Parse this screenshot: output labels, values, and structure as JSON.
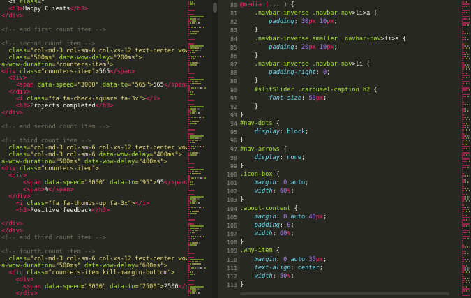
{
  "colors": {
    "background": "#272822",
    "tag": "#f92672",
    "attribute": "#a6e22e",
    "string": "#e6db74",
    "comment": "#75715e",
    "text": "#f8f8f2",
    "property": "#66d9ef",
    "number": "#ae81ff",
    "gutter_number": "#8f908a"
  },
  "left_editor": {
    "lines": [
      [
        [
          "  <i ",
          "txt"
        ],
        [
          "class",
          "attr"
        ],
        [
          "=\"",
          "txt"
        ]
      ],
      [
        [
          "  <h3>",
          "tag"
        ],
        [
          "Happy Clients",
          "txt"
        ],
        [
          "</h3>",
          "tag"
        ]
      ],
      [
        [
          "</div>",
          "tag"
        ]
      ],
      [
        [
          "",
          ""
        ]
      ],
      [
        [
          "<!-- end first count item -->",
          "cmt"
        ]
      ],
      [
        [
          "",
          ""
        ]
      ],
      [
        [
          "<!-- second count item -->",
          "cmt"
        ]
      ],
      [
        [
          "  class",
          "attr"
        ],
        [
          "=\"col-md-3 col-sm-6 col-xs-12 text-center wow fadeInDown\"",
          "str"
        ]
      ],
      [
        [
          "  class",
          "attr"
        ],
        [
          "=\"500ms\" ",
          "str"
        ],
        [
          "data-wow-delay",
          "attr"
        ],
        [
          "=\"200ms\">",
          "str"
        ]
      ],
      [
        [
          "a-wow-duration",
          "attr"
        ],
        [
          "=\"counters-item\">",
          "str"
        ]
      ],
      [
        [
          "<div ",
          "tag"
        ],
        [
          "class",
          "attr"
        ],
        [
          "=\"counters-item\">",
          "str"
        ],
        [
          "565",
          "txt"
        ],
        [
          "</span>",
          "tag"
        ]
      ],
      [
        [
          "  <div>",
          "tag"
        ]
      ],
      [
        [
          "    <span ",
          "tag"
        ],
        [
          "data-speed",
          "attr"
        ],
        [
          "=\"3000\" ",
          "str"
        ],
        [
          "data-to",
          "attr"
        ],
        [
          "=\"565\">",
          "str"
        ],
        [
          "565",
          "txt"
        ],
        [
          "</span>",
          "tag"
        ]
      ],
      [
        [
          "  </div>",
          "tag"
        ]
      ],
      [
        [
          "    <i ",
          "tag"
        ],
        [
          "class",
          "attr"
        ],
        [
          "=\"fa fa-check-square fa-3x\">",
          "str"
        ],
        [
          "</i>",
          "tag"
        ]
      ],
      [
        [
          "    <h3>",
          "tag"
        ],
        [
          "Projects completed",
          "txt"
        ],
        [
          "</h3>",
          "tag"
        ]
      ],
      [
        [
          "</div>",
          "tag"
        ]
      ],
      [
        [
          "",
          ""
        ]
      ],
      [
        [
          "<!-- end second count item -->",
          "cmt"
        ]
      ],
      [
        [
          "",
          ""
        ]
      ],
      [
        [
          "<!-- third count item -->",
          "cmt"
        ]
      ],
      [
        [
          "  class",
          "attr"
        ],
        [
          "=\"col-md-3 col-sm-6 col-xs-12 text-center wow fadeInDown\"",
          "str"
        ]
      ],
      [
        [
          "  class",
          "attr"
        ],
        [
          "=\"col-md-3 col-sm-6 ",
          "str"
        ],
        [
          "data-wow-delay",
          "attr"
        ],
        [
          "=\"400ms\">",
          "str"
        ]
      ],
      [
        [
          "a-wow-duration",
          "attr"
        ],
        [
          "=\"500ms\" ",
          "str"
        ],
        [
          "data-wow-delay",
          "attr"
        ],
        [
          "=\"400ms\">",
          "str"
        ]
      ],
      [
        [
          "<div ",
          "tag"
        ],
        [
          "class",
          "attr"
        ],
        [
          "=\"counters-item\">",
          "str"
        ]
      ],
      [
        [
          "  <div>",
          "tag"
        ]
      ],
      [
        [
          "      <span ",
          "tag"
        ],
        [
          "data-speed",
          "attr"
        ],
        [
          "=\"3000\" ",
          "str"
        ],
        [
          "data-to",
          "attr"
        ],
        [
          "=\"95\">",
          "str"
        ],
        [
          "95",
          "txt"
        ],
        [
          "</span>",
          "tag"
        ]
      ],
      [
        [
          "      <span>",
          "tag"
        ],
        [
          "%",
          "txt"
        ],
        [
          "</span>",
          "tag"
        ]
      ],
      [
        [
          "  </div>",
          "tag"
        ]
      ],
      [
        [
          "    <i ",
          "tag"
        ],
        [
          "class",
          "attr"
        ],
        [
          "=\"fa fa-thumbs-up fa-3x\">",
          "str"
        ],
        [
          "</i>",
          "tag"
        ]
      ],
      [
        [
          "    <h3>",
          "tag"
        ],
        [
          "Positive feedback",
          "txt"
        ],
        [
          "</h3>",
          "tag"
        ]
      ],
      [
        [
          "",
          ""
        ]
      ],
      [
        [
          "</div>",
          "tag"
        ]
      ],
      [
        [
          "</div>",
          "tag"
        ]
      ],
      [
        [
          "<!-- end third count item -->",
          "cmt"
        ]
      ],
      [
        [
          "",
          ""
        ]
      ],
      [
        [
          "<!-- fourth count item -->",
          "cmt"
        ]
      ],
      [
        [
          "  class",
          "attr"
        ],
        [
          "=\"col-md-3 col-sm-6 col-xs-12 text-center wow fadeInDown\"",
          "str"
        ]
      ],
      [
        [
          "a-wow-duration",
          "attr"
        ],
        [
          "=\"500ms\" ",
          "str"
        ],
        [
          "data-wow-delay",
          "attr"
        ],
        [
          "=\"600ms\">",
          "str"
        ]
      ],
      [
        [
          "  <div ",
          "tag"
        ],
        [
          "class",
          "attr"
        ],
        [
          "=\"counters-item kill-margin-bottom\">",
          "str"
        ]
      ],
      [
        [
          "    <div>",
          "tag"
        ]
      ],
      [
        [
          "      <span ",
          "tag"
        ],
        [
          "data-speed",
          "attr"
        ],
        [
          "=\"3000\" ",
          "str"
        ],
        [
          "data-to",
          "attr"
        ],
        [
          "=\"2500\">",
          "str"
        ],
        [
          "2500",
          "txt"
        ],
        [
          "</span>",
          "tag"
        ]
      ],
      [
        [
          "    </div>",
          "tag"
        ]
      ]
    ]
  },
  "right_editor": {
    "lines": [
      {
        "n": "80",
        "tokens": [
          [
            "@media (",
            "at"
          ],
          [
            "... ",
            "txt"
          ],
          [
            ") {",
            "txt"
          ]
        ]
      },
      {
        "n": "81",
        "tokens": [
          [
            "    .navbar-inverse .navbar-nav",
            "sel"
          ],
          [
            ">li>a {",
            "txt"
          ]
        ]
      },
      {
        "n": "82",
        "tokens": [
          [
            "        padding",
            "prop"
          ],
          [
            ": ",
            "txt"
          ],
          [
            "30",
            "num"
          ],
          [
            "px ",
            "unit"
          ],
          [
            "10",
            "num"
          ],
          [
            "px",
            "unit"
          ],
          [
            ";",
            "txt"
          ]
        ]
      },
      {
        "n": "83",
        "tokens": [
          [
            "    }",
            "txt"
          ]
        ]
      },
      {
        "n": "84",
        "tokens": [
          [
            "    .navbar-inverse.smaller .navbar-nav",
            "sel"
          ],
          [
            ">li>a {",
            "txt"
          ]
        ]
      },
      {
        "n": "85",
        "tokens": [
          [
            "        padding",
            "prop"
          ],
          [
            ": ",
            "txt"
          ],
          [
            "20",
            "num"
          ],
          [
            "px ",
            "unit"
          ],
          [
            "10",
            "num"
          ],
          [
            "px",
            "unit"
          ],
          [
            ";",
            "txt"
          ]
        ]
      },
      {
        "n": "86",
        "tokens": [
          [
            "    }",
            "txt"
          ]
        ]
      },
      {
        "n": "87",
        "tokens": [
          [
            "    .navbar-inverse .navbar-nav",
            "sel"
          ],
          [
            ">li {",
            "txt"
          ]
        ]
      },
      {
        "n": "88",
        "tokens": [
          [
            "        padding-right",
            "prop"
          ],
          [
            ": ",
            "txt"
          ],
          [
            "0",
            "num"
          ],
          [
            ";",
            "txt"
          ]
        ]
      },
      {
        "n": "89",
        "tokens": [
          [
            "    }",
            "txt"
          ]
        ]
      },
      {
        "n": "90",
        "tokens": [
          [
            "    #slitSlider .carousel-caption h2",
            "sel"
          ],
          [
            " {",
            "txt"
          ]
        ]
      },
      {
        "n": "91",
        "tokens": [
          [
            "        font-size",
            "prop"
          ],
          [
            ": ",
            "txt"
          ],
          [
            "50",
            "num"
          ],
          [
            "px",
            "unit"
          ],
          [
            ";",
            "txt"
          ]
        ]
      },
      {
        "n": "92",
        "tokens": [
          [
            "    }",
            "txt"
          ]
        ]
      },
      {
        "n": "93",
        "tokens": [
          [
            "}",
            "txt"
          ]
        ]
      },
      {
        "n": "94",
        "tokens": [
          [
            "#nav-dots",
            "sel"
          ],
          [
            " {",
            "txt"
          ]
        ]
      },
      {
        "n": "95",
        "tokens": [
          [
            "    display",
            "prop"
          ],
          [
            ": ",
            "txt"
          ],
          [
            "block",
            "val"
          ],
          [
            ";",
            "txt"
          ]
        ]
      },
      {
        "n": "96",
        "tokens": [
          [
            "}",
            "txt"
          ]
        ]
      },
      {
        "n": "97",
        "tokens": [
          [
            "#nav-arrows",
            "sel"
          ],
          [
            " {",
            "txt"
          ]
        ]
      },
      {
        "n": "98",
        "tokens": [
          [
            "    display",
            "prop"
          ],
          [
            ": ",
            "txt"
          ],
          [
            "none",
            "val"
          ],
          [
            ";",
            "txt"
          ]
        ]
      },
      {
        "n": "99",
        "tokens": [
          [
            "}",
            "txt"
          ]
        ]
      },
      {
        "n": "100",
        "tokens": [
          [
            ".icon-box",
            "sel"
          ],
          [
            " {",
            "txt"
          ]
        ]
      },
      {
        "n": "101",
        "tokens": [
          [
            "    margin",
            "prop"
          ],
          [
            ": ",
            "txt"
          ],
          [
            "0",
            "num"
          ],
          [
            " auto",
            "val"
          ],
          [
            ";",
            "txt"
          ]
        ]
      },
      {
        "n": "102",
        "tokens": [
          [
            "    width",
            "prop"
          ],
          [
            ": ",
            "txt"
          ],
          [
            "60",
            "num"
          ],
          [
            "%",
            "unit"
          ],
          [
            ";",
            "txt"
          ]
        ]
      },
      {
        "n": "103",
        "tokens": [
          [
            "}",
            "txt"
          ]
        ]
      },
      {
        "n": "104",
        "tokens": [
          [
            ".about-content",
            "sel"
          ],
          [
            " {",
            "txt"
          ]
        ]
      },
      {
        "n": "105",
        "tokens": [
          [
            "    margin",
            "prop"
          ],
          [
            ": ",
            "txt"
          ],
          [
            "0",
            "num"
          ],
          [
            " auto ",
            "val"
          ],
          [
            "40",
            "num"
          ],
          [
            "px",
            "unit"
          ],
          [
            ";",
            "txt"
          ]
        ]
      },
      {
        "n": "106",
        "tokens": [
          [
            "    padding",
            "prop"
          ],
          [
            ": ",
            "txt"
          ],
          [
            "0",
            "num"
          ],
          [
            ";",
            "txt"
          ]
        ]
      },
      {
        "n": "107",
        "tokens": [
          [
            "    width",
            "prop"
          ],
          [
            ": ",
            "txt"
          ],
          [
            "60",
            "num"
          ],
          [
            "%",
            "unit"
          ],
          [
            ";",
            "txt"
          ]
        ]
      },
      {
        "n": "108",
        "tokens": [
          [
            "}",
            "txt"
          ]
        ]
      },
      {
        "n": "109",
        "tokens": [
          [
            ".why-item",
            "sel"
          ],
          [
            " {",
            "txt"
          ]
        ]
      },
      {
        "n": "110",
        "tokens": [
          [
            "    margin",
            "prop"
          ],
          [
            ": ",
            "txt"
          ],
          [
            "0",
            "num"
          ],
          [
            " auto ",
            "val"
          ],
          [
            "35",
            "num"
          ],
          [
            "px",
            "unit"
          ],
          [
            ";",
            "txt"
          ]
        ]
      },
      {
        "n": "111",
        "tokens": [
          [
            "    text-align",
            "prop"
          ],
          [
            ": ",
            "txt"
          ],
          [
            "center",
            "val"
          ],
          [
            ";",
            "txt"
          ]
        ]
      },
      {
        "n": "112",
        "tokens": [
          [
            "    width",
            "prop"
          ],
          [
            ": ",
            "txt"
          ],
          [
            "50",
            "num"
          ],
          [
            "%",
            "unit"
          ],
          [
            ";",
            "txt"
          ]
        ]
      },
      {
        "n": "113",
        "tokens": [
          [
            "}",
            "txt"
          ]
        ]
      }
    ]
  }
}
